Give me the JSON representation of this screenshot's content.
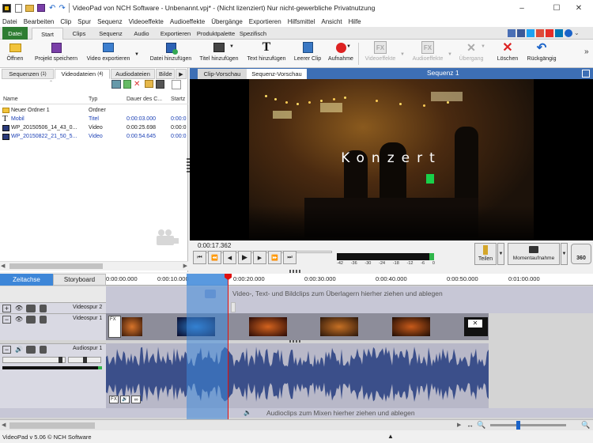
{
  "window": {
    "title": "VideoPad von NCH Software - Unbenannt.vpj* - (Nicht lizenziert) Nur nicht-gewerbliche Privatnutzung",
    "controls": [
      "–",
      "☐",
      "✕"
    ]
  },
  "menu": [
    "Datei",
    "Bearbeiten",
    "Clip",
    "Spur",
    "Sequenz",
    "Videoeffekte",
    "Audioeffekte",
    "Übergänge",
    "Exportieren",
    "Hilfsmittel",
    "Ansicht",
    "Hilfe"
  ],
  "ribbon_tabs": [
    "Datei",
    "Start",
    "Clips",
    "Sequenz",
    "Audio",
    "Exportieren",
    "Produktpalette",
    "Spezifisch"
  ],
  "active_ribbon_tab": "Start",
  "toolbar": {
    "open": "Öffnen",
    "save_project": "Projekt speichern",
    "export_video": "Video exportieren",
    "add_file": "Datei hinzufügen",
    "add_title": "Titel hinzufügen",
    "add_text": "Text hinzufügen",
    "empty_clip": "Leerer Clip",
    "record": "Aufnahme",
    "video_effects": "Videoeffekte",
    "audio_effects": "Audioeffekte",
    "transition": "Übergang",
    "delete": "Löschen",
    "undo": "Rückgängig"
  },
  "bin_tabs": {
    "sequences": "Sequenzen",
    "sequences_count": "(1)",
    "videofiles": "Videodateien",
    "videofiles_count": "(4)",
    "audiofiles": "Audiodateien",
    "images": "Bilde"
  },
  "bin_columns": [
    "Name",
    "Typ",
    "Dauer des C...",
    "Startz"
  ],
  "bin_rows": [
    {
      "name": "Neuer Ordner 1",
      "type": "Ordner",
      "duration": "",
      "start": ""
    },
    {
      "name": "Mobil",
      "type": "Titel",
      "duration": "0:00:03.000",
      "start": "0:00:0"
    },
    {
      "name": "WP_20150506_14_43_0...",
      "type": "Video",
      "duration": "0:00:25.698",
      "start": "0:00:0"
    },
    {
      "name": "WP_20150822_21_50_5...",
      "type": "Video",
      "duration": "0:00:54.645",
      "start": "0:00:0"
    }
  ],
  "preview": {
    "tab_clip": "Clip-Vorschau",
    "tab_sequence": "Sequenz-Vorschau",
    "sequence_label": "Sequenz 1",
    "overlay_text": "Konzert",
    "timecode": "0:00:17.362",
    "meter_ticks": [
      "-42",
      "-36",
      "-30",
      "-24",
      "-18",
      "-12",
      "-6",
      "0"
    ],
    "split_label": "Teilen",
    "snapshot_label": "Momentaufnahme",
    "view360_label": "360"
  },
  "timeline": {
    "tab_timeline": "Zeitachse",
    "tab_storyboard": "Storyboard",
    "ruler": [
      "0:00:00.000",
      "0:00:10.000",
      "0:00:20.000",
      "0:00:30.000",
      "0:00:40.000",
      "0:00:50.000",
      "0:01:00.000"
    ],
    "video_track_2": "Videospur 2",
    "video_track_1": "Videospur 1",
    "audio_track_1": "Audiospur 1",
    "overlay_hint": "Video-, Text- und Bildclips zum Überlagern hierher ziehen und ablegen",
    "audio_hint": "Audioclips zum Mixen hierher ziehen und ablegen",
    "fx_label": "FX"
  },
  "status": {
    "version": "VideoPad v 5.06 © NCH Software"
  },
  "colors": {
    "accent_blue": "#1a63c9",
    "file_tab_green": "#2e7d32",
    "timeline_selection": "#3d86d8",
    "playhead_red": "#e01010",
    "audio_wave": "#3b4f8a"
  }
}
